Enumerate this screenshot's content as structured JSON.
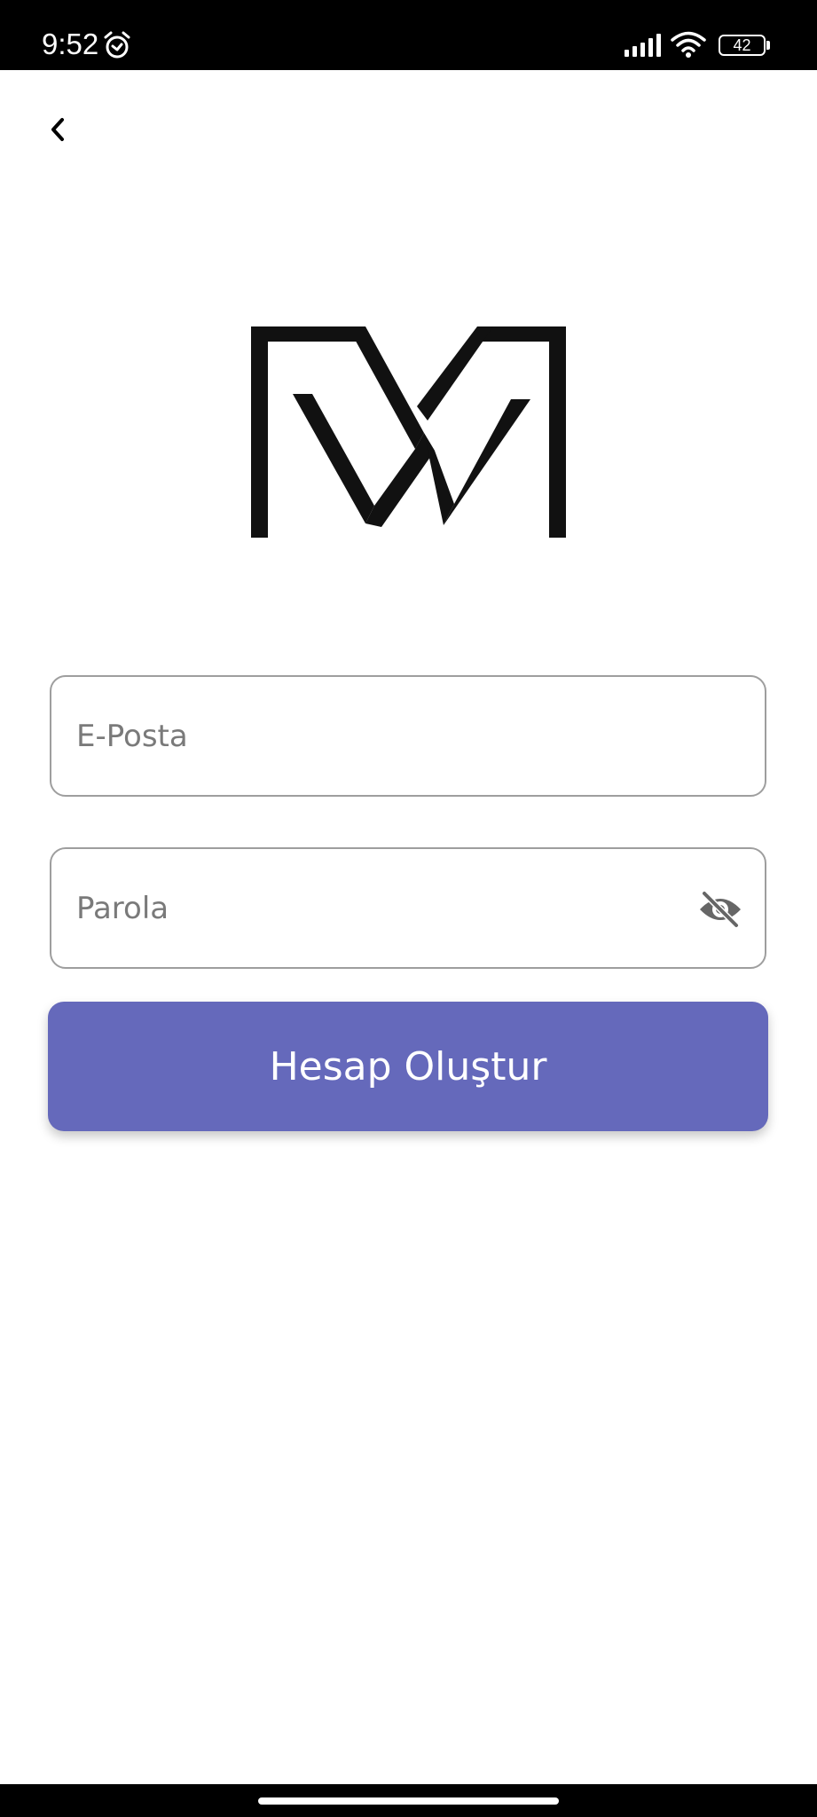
{
  "status_bar": {
    "time": "9:52",
    "battery_level": "42",
    "icons": [
      "alarm-icon",
      "signal-icon",
      "wifi-icon",
      "battery-icon"
    ]
  },
  "nav": {
    "back_icon": "chevron-left-icon"
  },
  "logo": {
    "name": "monogram-logo"
  },
  "form": {
    "email_placeholder": "E-Posta",
    "email_value": "",
    "password_placeholder": "Parola",
    "password_value": "",
    "password_toggle_icon": "eye-off-icon",
    "submit_label": "Hesap Oluştur"
  },
  "colors": {
    "primary": "#6569bb",
    "field_border": "#9e9e9e",
    "status_bar": "#000000",
    "background": "#ffffff"
  }
}
